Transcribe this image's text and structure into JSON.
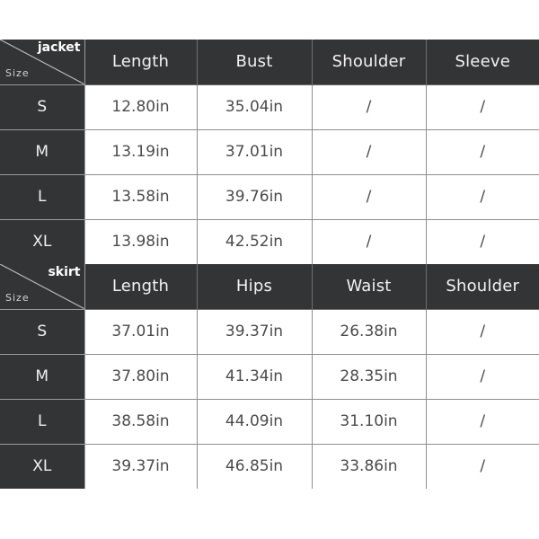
{
  "page": {
    "background_color": "#ffffff",
    "header_background_color": "#333436",
    "cell_text_color": "#4b4b4b",
    "header_text_color": "#f2f2f2",
    "empty_value": "/"
  },
  "tables": [
    {
      "category_label": "jacket",
      "size_label": "Size",
      "columns": [
        "Length",
        "Bust",
        "Shoulder",
        "Sleeve"
      ],
      "rows": [
        {
          "size": "S",
          "values": [
            "12.80in",
            "35.04in",
            "/",
            "/"
          ]
        },
        {
          "size": "M",
          "values": [
            "13.19in",
            "37.01in",
            "/",
            "/"
          ]
        },
        {
          "size": "L",
          "values": [
            "13.58in",
            "39.76in",
            "/",
            "/"
          ]
        },
        {
          "size": "XL",
          "values": [
            "13.98in",
            "42.52in",
            "/",
            "/"
          ]
        }
      ]
    },
    {
      "category_label": "skirt",
      "size_label": "Size",
      "columns": [
        "Length",
        "Hips",
        "Waist",
        "Shoulder"
      ],
      "rows": [
        {
          "size": "S",
          "values": [
            "37.01in",
            "39.37in",
            "26.38in",
            "/"
          ]
        },
        {
          "size": "M",
          "values": [
            "37.80in",
            "41.34in",
            "28.35in",
            "/"
          ]
        },
        {
          "size": "L",
          "values": [
            "38.58in",
            "44.09in",
            "31.10in",
            "/"
          ]
        },
        {
          "size": "XL",
          "values": [
            "39.37in",
            "46.85in",
            "33.86in",
            "/"
          ]
        }
      ]
    }
  ]
}
